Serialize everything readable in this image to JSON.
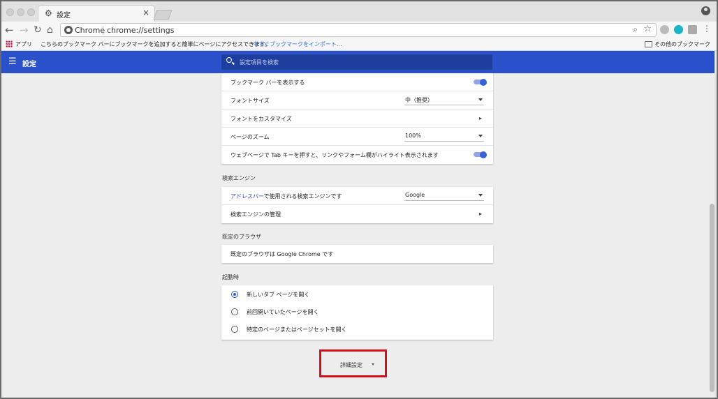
{
  "browser": {
    "tab_title": "設定",
    "omnibox_brand": "Chrome",
    "url": "chrome://settings"
  },
  "bookmarks_bar": {
    "apps_label": "アプリ",
    "hint_text": "こちらのブックマーク バーにブックマークを追加すると簡単にページにアクセスできます。",
    "import_link": "今すぐブックマークをインポート...",
    "other_bookmarks": "その他のブックマーク"
  },
  "header": {
    "title": "設定",
    "search_placeholder": "設定項目を検索"
  },
  "appearance": {
    "rows": [
      {
        "label": "ブックマーク バーを表示する",
        "toggle": true
      },
      {
        "label": "フォントサイズ",
        "select": "中（推奨）"
      },
      {
        "label": "フォントをカスタマイズ"
      },
      {
        "label": "ページのズーム",
        "select": "100%"
      },
      {
        "label": "ウェブページで Tab キーを押すと、リンクやフォーム欄がハイライト表示されます",
        "toggle": true
      }
    ]
  },
  "search_engine": {
    "title": "検索エンジン",
    "row1_link": "アドレスバー",
    "row1_rest": "で使用される検索エンジンです",
    "row1_value": "Google",
    "row2_label": "検索エンジンの管理"
  },
  "default_browser": {
    "title": "既定のブラウザ",
    "text": "既定のブラウザは Google Chrome です"
  },
  "startup": {
    "title": "起動時",
    "options": [
      {
        "label": "新しいタブ ページを開く",
        "checked": true
      },
      {
        "label": "前回開いていたページを開く",
        "checked": false
      },
      {
        "label": "特定のページまたはページセットを開く",
        "checked": false
      }
    ]
  },
  "advanced": {
    "label": "詳細設定"
  },
  "colors": {
    "header_blue": "#2a51c9",
    "highlight_red": "#d0101b",
    "toggle_blue": "#3a62d8"
  }
}
